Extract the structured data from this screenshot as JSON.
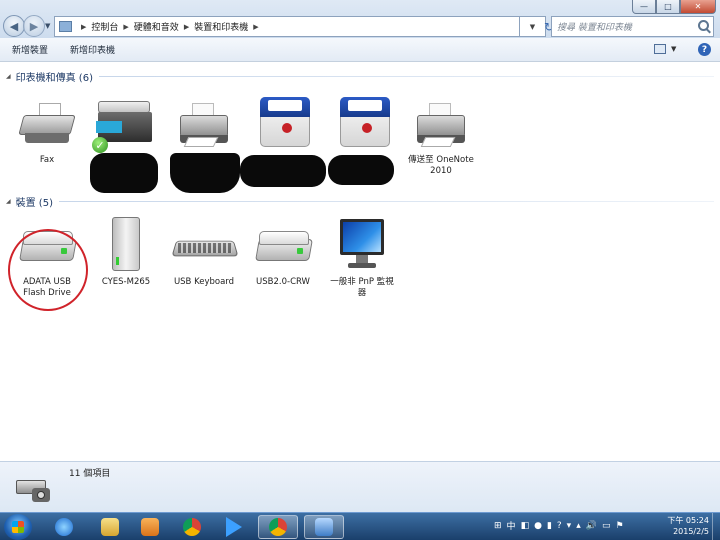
{
  "address_bar": {
    "crumbs": [
      "控制台",
      "硬體和音效",
      "裝置和印表機"
    ],
    "search_placeholder": "搜尋 裝置和印表機"
  },
  "window_controls": {
    "minimize": "—",
    "maximize": "□",
    "close": "✕"
  },
  "command_bar": {
    "add_device": "新增裝置",
    "add_printer": "新增印表機",
    "help": "?"
  },
  "printers_group": {
    "title": "印表機和傳真 (6)",
    "items": [
      {
        "label": "Fax",
        "icon": "fax-icon"
      },
      {
        "label": "",
        "icon": "mfp-printer-icon",
        "default": true
      },
      {
        "label": "",
        "icon": "printer-icon"
      },
      {
        "label": "",
        "icon": "xerox-printer-icon"
      },
      {
        "label": "",
        "icon": "xerox-printer-icon"
      },
      {
        "label": "傳送至 OneNote 2010",
        "icon": "printer-icon"
      }
    ]
  },
  "devices_group": {
    "title": "裝置 (5)",
    "items": [
      {
        "label": "ADATA USB Flash Drive",
        "icon": "usb-drive-icon"
      },
      {
        "label": "CYES-M265",
        "icon": "external-drive-icon"
      },
      {
        "label": "USB Keyboard",
        "icon": "keyboard-icon"
      },
      {
        "label": "USB2.0-CRW",
        "icon": "card-reader-icon"
      },
      {
        "label": "一般非 PnP 監視器",
        "icon": "monitor-icon"
      }
    ]
  },
  "details_pane": {
    "count": "11 個項目"
  },
  "taskbar": {
    "tray_text": "中",
    "time": "下午 05:24",
    "date": "2015/2/5"
  },
  "colors": {
    "accent": "#1e3a66",
    "highlight_ring": "#d0232a",
    "taskbar": "#1a3f6b"
  }
}
